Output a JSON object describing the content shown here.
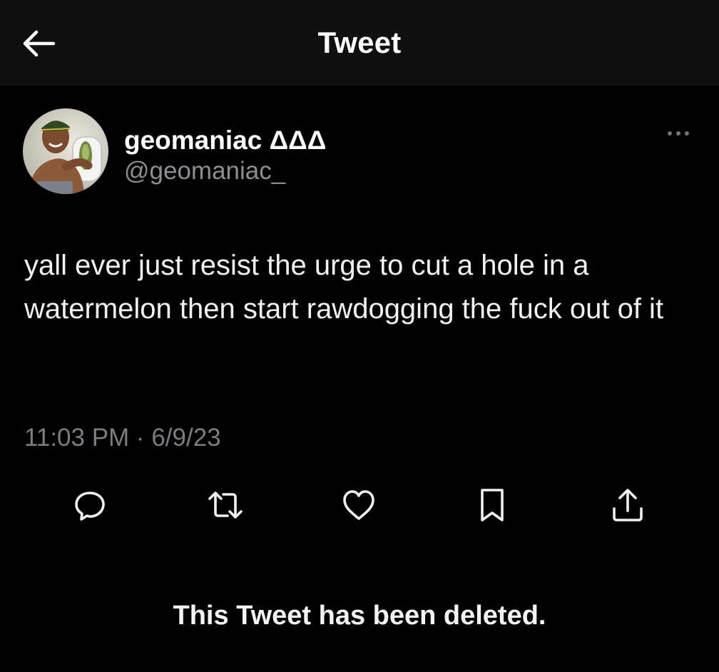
{
  "header": {
    "back_icon": "arrow-left-icon",
    "title": "Tweet"
  },
  "tweet": {
    "author": {
      "display_name": "geomaniac ΔΔΔ",
      "handle": "@geomaniac_"
    },
    "more_icon": "more-horizontal-icon",
    "text": "yall ever just resist the urge to cut a hole in a watermelon then start rawdogging the fuck out of it",
    "timestamp": "11:03 PM · 6/9/23",
    "actions": [
      {
        "name": "reply",
        "icon": "reply-icon"
      },
      {
        "name": "retweet",
        "icon": "retweet-icon"
      },
      {
        "name": "like",
        "icon": "heart-icon"
      },
      {
        "name": "bookmark",
        "icon": "bookmark-icon"
      },
      {
        "name": "share",
        "icon": "share-icon"
      }
    ]
  },
  "notice": "This Tweet has been deleted.",
  "colors": {
    "background": "#000000",
    "header_background": "#101010",
    "primary_text": "#e7e9ea",
    "secondary_text": "#71767b"
  }
}
